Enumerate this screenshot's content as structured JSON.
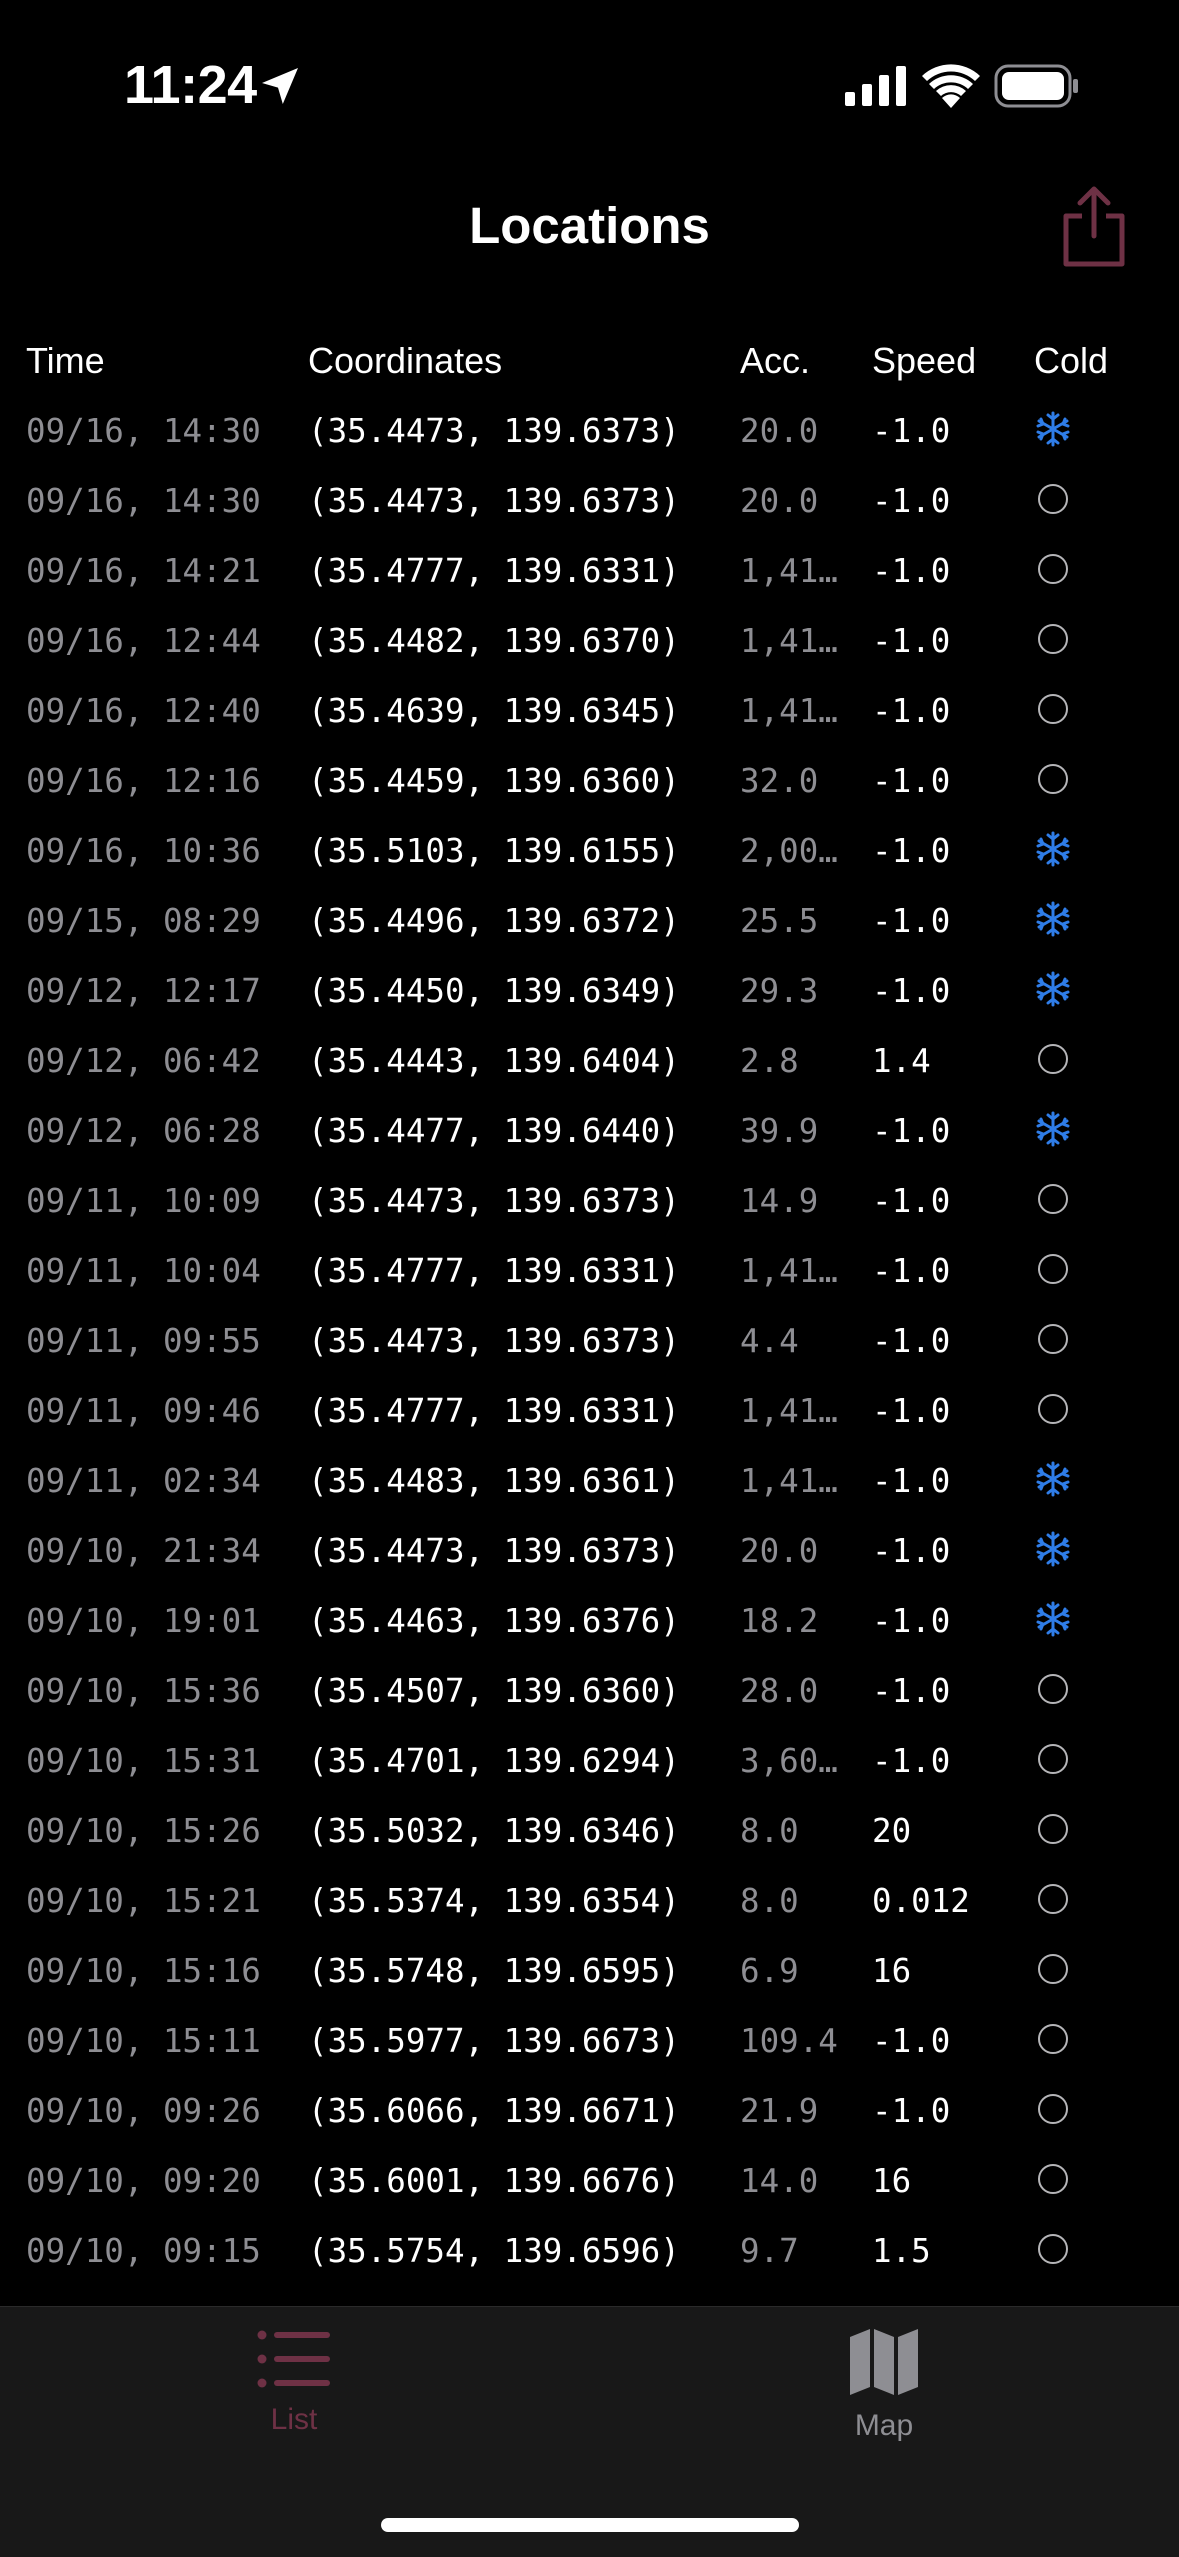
{
  "status_bar": {
    "time": "11:24"
  },
  "nav": {
    "title": "Locations"
  },
  "table": {
    "headers": {
      "time": "Time",
      "coordinates": "Coordinates",
      "accuracy": "Acc.",
      "speed": "Speed",
      "cold": "Cold"
    },
    "rows": [
      {
        "time": "09/16, 14:30",
        "coord": "(35.4473, 139.6373)",
        "acc": "20.0",
        "speed": "-1.0",
        "cold": true
      },
      {
        "time": "09/16, 14:30",
        "coord": "(35.4473, 139.6373)",
        "acc": "20.0",
        "speed": "-1.0",
        "cold": false
      },
      {
        "time": "09/16, 14:21",
        "coord": "(35.4777, 139.6331)",
        "acc": "1,41…",
        "speed": "-1.0",
        "cold": false
      },
      {
        "time": "09/16, 12:44",
        "coord": "(35.4482, 139.6370)",
        "acc": "1,41…",
        "speed": "-1.0",
        "cold": false
      },
      {
        "time": "09/16, 12:40",
        "coord": "(35.4639, 139.6345)",
        "acc": "1,41…",
        "speed": "-1.0",
        "cold": false
      },
      {
        "time": "09/16, 12:16",
        "coord": "(35.4459, 139.6360)",
        "acc": "32.0",
        "speed": "-1.0",
        "cold": false
      },
      {
        "time": "09/16, 10:36",
        "coord": "(35.5103, 139.6155)",
        "acc": "2,00…",
        "speed": "-1.0",
        "cold": true
      },
      {
        "time": "09/15, 08:29",
        "coord": "(35.4496, 139.6372)",
        "acc": "25.5",
        "speed": "-1.0",
        "cold": true
      },
      {
        "time": "09/12, 12:17",
        "coord": "(35.4450, 139.6349)",
        "acc": "29.3",
        "speed": "-1.0",
        "cold": true
      },
      {
        "time": "09/12, 06:42",
        "coord": "(35.4443, 139.6404)",
        "acc": "2.8",
        "speed": "1.4",
        "cold": false
      },
      {
        "time": "09/12, 06:28",
        "coord": "(35.4477, 139.6440)",
        "acc": "39.9",
        "speed": "-1.0",
        "cold": true
      },
      {
        "time": "09/11, 10:09",
        "coord": "(35.4473, 139.6373)",
        "acc": "14.9",
        "speed": "-1.0",
        "cold": false
      },
      {
        "time": "09/11, 10:04",
        "coord": "(35.4777, 139.6331)",
        "acc": "1,41…",
        "speed": "-1.0",
        "cold": false
      },
      {
        "time": "09/11, 09:55",
        "coord": "(35.4473, 139.6373)",
        "acc": "4.4",
        "speed": "-1.0",
        "cold": false
      },
      {
        "time": "09/11, 09:46",
        "coord": "(35.4777, 139.6331)",
        "acc": "1,41…",
        "speed": "-1.0",
        "cold": false
      },
      {
        "time": "09/11, 02:34",
        "coord": "(35.4483, 139.6361)",
        "acc": "1,41…",
        "speed": "-1.0",
        "cold": true
      },
      {
        "time": "09/10, 21:34",
        "coord": "(35.4473, 139.6373)",
        "acc": "20.0",
        "speed": "-1.0",
        "cold": true
      },
      {
        "time": "09/10, 19:01",
        "coord": "(35.4463, 139.6376)",
        "acc": "18.2",
        "speed": "-1.0",
        "cold": true
      },
      {
        "time": "09/10, 15:36",
        "coord": "(35.4507, 139.6360)",
        "acc": "28.0",
        "speed": "-1.0",
        "cold": false
      },
      {
        "time": "09/10, 15:31",
        "coord": "(35.4701, 139.6294)",
        "acc": "3,60…",
        "speed": "-1.0",
        "cold": false
      },
      {
        "time": "09/10, 15:26",
        "coord": "(35.5032, 139.6346)",
        "acc": "8.0",
        "speed": "20",
        "cold": false
      },
      {
        "time": "09/10, 15:21",
        "coord": "(35.5374, 139.6354)",
        "acc": "8.0",
        "speed": "0.012",
        "cold": false
      },
      {
        "time": "09/10, 15:16",
        "coord": "(35.5748, 139.6595)",
        "acc": "6.9",
        "speed": "16",
        "cold": false
      },
      {
        "time": "09/10, 15:11",
        "coord": "(35.5977, 139.6673)",
        "acc": "109.4",
        "speed": "-1.0",
        "cold": false
      },
      {
        "time": "09/10, 09:26",
        "coord": "(35.6066, 139.6671)",
        "acc": "21.9",
        "speed": "-1.0",
        "cold": false
      },
      {
        "time": "09/10, 09:20",
        "coord": "(35.6001, 139.6676)",
        "acc": "14.0",
        "speed": "16",
        "cold": false
      },
      {
        "time": "09/10, 09:15",
        "coord": "(35.5754, 139.6596)",
        "acc": "9.7",
        "speed": "1.5",
        "cold": false
      }
    ]
  },
  "tab_bar": {
    "tabs": [
      {
        "label": "List",
        "icon": "list-icon",
        "selected": true
      },
      {
        "label": "Map",
        "icon": "map-icon",
        "selected": false
      }
    ]
  },
  "colors": {
    "accent": "#6e3145",
    "cold_icon": "#2f7de8",
    "secondary_text": "#8e8e93"
  }
}
